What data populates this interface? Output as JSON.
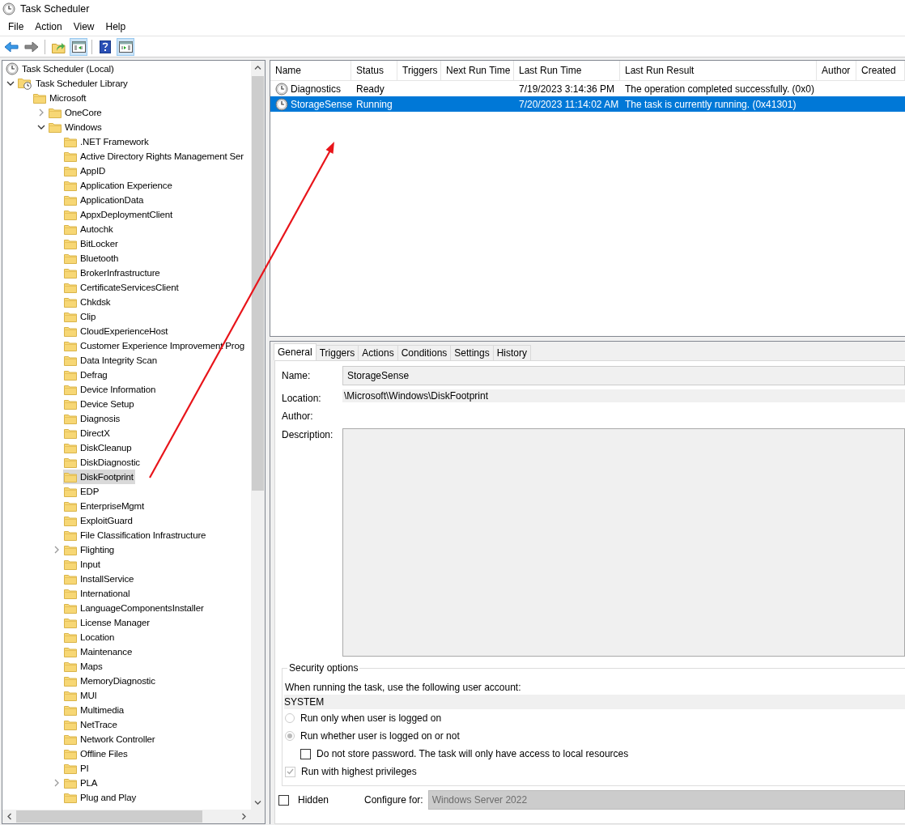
{
  "window": {
    "title": "Task Scheduler"
  },
  "menu": [
    "File",
    "Action",
    "View",
    "Help"
  ],
  "toolbar": [
    [
      {
        "kind": "back",
        "pressed": false
      },
      {
        "kind": "forward",
        "pressed": false
      }
    ],
    [
      {
        "kind": "folder-up",
        "pressed": false
      },
      {
        "kind": "tree-pane",
        "pressed": true
      }
    ],
    [
      {
        "kind": "help",
        "pressed": false
      },
      {
        "kind": "action-pane",
        "pressed": true
      }
    ]
  ],
  "tree": [
    {
      "label": "Task Scheduler (Local)",
      "kind": "root",
      "selected": false,
      "children": [
        {
          "label": "Task Scheduler Library",
          "kind": "library",
          "expanded": true,
          "selected": false,
          "children": [
            {
              "label": "Microsoft",
              "kind": "folder",
              "selected": false,
              "children": [
                {
                  "label": "OneCore",
                  "kind": "folder",
                  "expanded": false,
                  "selected": false
                },
                {
                  "label": "Windows",
                  "kind": "folder",
                  "expanded": true,
                  "selected": false,
                  "children": [
                    {
                      "label": ".NET Framework",
                      "kind": "folder",
                      "selected": false
                    },
                    {
                      "label": "Active Directory Rights Management Ser",
                      "kind": "folder",
                      "selected": false
                    },
                    {
                      "label": "AppID",
                      "kind": "folder",
                      "selected": false
                    },
                    {
                      "label": "Application Experience",
                      "kind": "folder",
                      "selected": false
                    },
                    {
                      "label": "ApplicationData",
                      "kind": "folder",
                      "selected": false
                    },
                    {
                      "label": "AppxDeploymentClient",
                      "kind": "folder",
                      "selected": false
                    },
                    {
                      "label": "Autochk",
                      "kind": "folder",
                      "selected": false
                    },
                    {
                      "label": "BitLocker",
                      "kind": "folder",
                      "selected": false
                    },
                    {
                      "label": "Bluetooth",
                      "kind": "folder",
                      "selected": false
                    },
                    {
                      "label": "BrokerInfrastructure",
                      "kind": "folder",
                      "selected": false
                    },
                    {
                      "label": "CertificateServicesClient",
                      "kind": "folder",
                      "selected": false
                    },
                    {
                      "label": "Chkdsk",
                      "kind": "folder",
                      "selected": false
                    },
                    {
                      "label": "Clip",
                      "kind": "folder",
                      "selected": false
                    },
                    {
                      "label": "CloudExperienceHost",
                      "kind": "folder",
                      "selected": false
                    },
                    {
                      "label": "Customer Experience Improvement Prog",
                      "kind": "folder",
                      "selected": false
                    },
                    {
                      "label": "Data Integrity Scan",
                      "kind": "folder",
                      "selected": false
                    },
                    {
                      "label": "Defrag",
                      "kind": "folder",
                      "selected": false
                    },
                    {
                      "label": "Device Information",
                      "kind": "folder",
                      "selected": false
                    },
                    {
                      "label": "Device Setup",
                      "kind": "folder",
                      "selected": false
                    },
                    {
                      "label": "Diagnosis",
                      "kind": "folder",
                      "selected": false
                    },
                    {
                      "label": "DirectX",
                      "kind": "folder",
                      "selected": false
                    },
                    {
                      "label": "DiskCleanup",
                      "kind": "folder",
                      "selected": false
                    },
                    {
                      "label": "DiskDiagnostic",
                      "kind": "folder",
                      "selected": false
                    },
                    {
                      "label": "DiskFootprint",
                      "kind": "folder",
                      "selected": true
                    },
                    {
                      "label": "EDP",
                      "kind": "folder",
                      "selected": false
                    },
                    {
                      "label": "EnterpriseMgmt",
                      "kind": "folder",
                      "selected": false
                    },
                    {
                      "label": "ExploitGuard",
                      "kind": "folder",
                      "selected": false
                    },
                    {
                      "label": "File Classification Infrastructure",
                      "kind": "folder",
                      "selected": false
                    },
                    {
                      "label": "Flighting",
                      "kind": "folder",
                      "expanded": false,
                      "selected": false
                    },
                    {
                      "label": "Input",
                      "kind": "folder",
                      "selected": false
                    },
                    {
                      "label": "InstallService",
                      "kind": "folder",
                      "selected": false
                    },
                    {
                      "label": "International",
                      "kind": "folder",
                      "selected": false
                    },
                    {
                      "label": "LanguageComponentsInstaller",
                      "kind": "folder",
                      "selected": false
                    },
                    {
                      "label": "License Manager",
                      "kind": "folder",
                      "selected": false
                    },
                    {
                      "label": "Location",
                      "kind": "folder",
                      "selected": false
                    },
                    {
                      "label": "Maintenance",
                      "kind": "folder",
                      "selected": false
                    },
                    {
                      "label": "Maps",
                      "kind": "folder",
                      "selected": false
                    },
                    {
                      "label": "MemoryDiagnostic",
                      "kind": "folder",
                      "selected": false
                    },
                    {
                      "label": "MUI",
                      "kind": "folder",
                      "selected": false
                    },
                    {
                      "label": "Multimedia",
                      "kind": "folder",
                      "selected": false
                    },
                    {
                      "label": "NetTrace",
                      "kind": "folder",
                      "selected": false
                    },
                    {
                      "label": "Network Controller",
                      "kind": "folder",
                      "selected": false
                    },
                    {
                      "label": "Offline Files",
                      "kind": "folder",
                      "selected": false
                    },
                    {
                      "label": "PI",
                      "kind": "folder",
                      "selected": false
                    },
                    {
                      "label": "PLA",
                      "kind": "folder",
                      "expanded": false,
                      "selected": false
                    },
                    {
                      "label": "Plug and Play",
                      "kind": "folder",
                      "selected": false
                    }
                  ]
                }
              ]
            }
          ]
        }
      ]
    }
  ],
  "table": {
    "columns": [
      "Name",
      "Status",
      "Triggers",
      "Next Run Time",
      "Last Run Time",
      "Last Run Result",
      "Author",
      "Created"
    ],
    "rows": [
      {
        "selected": false,
        "cells": [
          "Diagnostics",
          "Ready",
          "",
          "",
          "7/19/2023 3:14:36 PM",
          "The operation completed successfully. (0x0)",
          "",
          ""
        ]
      },
      {
        "selected": true,
        "cells": [
          "StorageSense",
          "Running",
          "",
          "",
          "7/20/2023 11:14:02 AM",
          "The task is currently running. (0x41301)",
          "",
          ""
        ]
      }
    ]
  },
  "details": {
    "tabs": [
      {
        "label": "General",
        "selected": true
      },
      {
        "label": "Triggers",
        "selected": false
      },
      {
        "label": "Actions",
        "selected": false
      },
      {
        "label": "Conditions",
        "selected": false
      },
      {
        "label": "Settings",
        "selected": false
      },
      {
        "label": "History",
        "selected": false
      }
    ],
    "name": {
      "label": "Name:",
      "value": "StorageSense"
    },
    "location": {
      "label": "Location:",
      "value": "\\Microsoft\\Windows\\DiskFootprint"
    },
    "author": {
      "label": "Author:"
    },
    "description": {
      "label": "Description:"
    },
    "security": {
      "title": "Security options",
      "account_label": "When running the task, use the following user account:",
      "account": "SYSTEM",
      "options": [
        {
          "kind": "radio",
          "label": "Run only when user is logged on",
          "selected": false,
          "disabled": true
        },
        {
          "kind": "radio",
          "label": "Run whether user is logged on or not",
          "selected": true,
          "disabled": true
        },
        {
          "kind": "checkbox",
          "label": "Do not store password.  The task will only have access to local resources",
          "checked": false,
          "disabled": false
        },
        {
          "kind": "checkbox",
          "label": "Run with highest privileges",
          "checked": true,
          "disabled": true
        }
      ]
    },
    "hidden": {
      "label": "Hidden",
      "checked": false
    },
    "configure": {
      "label": "Configure for:",
      "value": "Windows Server 2022"
    }
  }
}
